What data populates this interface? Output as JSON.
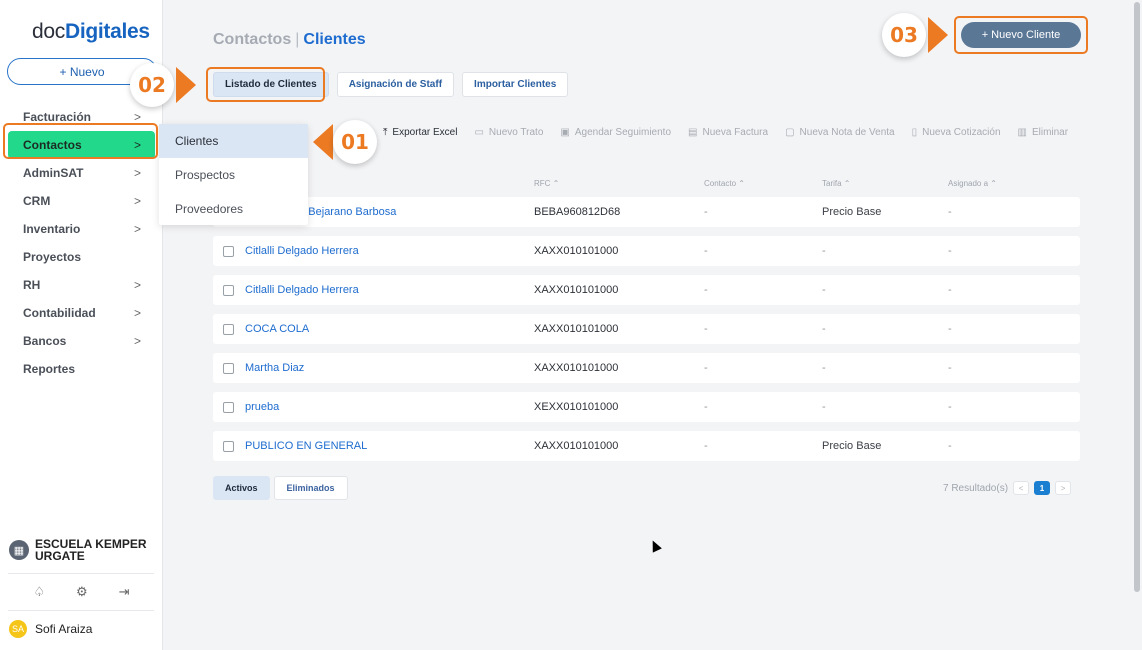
{
  "sidebar": {
    "logo_prefix": "doc",
    "logo_brand": "Digitales",
    "nuevo_button": "+ Nuevo",
    "items": [
      {
        "label": "Facturación",
        "chevron": ">"
      },
      {
        "label": "Contactos",
        "chevron": ">"
      },
      {
        "label": "AdminSAT",
        "chevron": ">"
      },
      {
        "label": "CRM",
        "chevron": ">"
      },
      {
        "label": "Inventario",
        "chevron": ">"
      },
      {
        "label": "Proyectos",
        "chevron": ""
      },
      {
        "label": "RH",
        "chevron": ">"
      },
      {
        "label": "Contabilidad",
        "chevron": ">"
      },
      {
        "label": "Bancos",
        "chevron": ">"
      },
      {
        "label": "Reportes",
        "chevron": ""
      }
    ],
    "org_name": "ESCUELA KEMPER URGATE",
    "user_initials": "SA",
    "user_name": "Sofi Araiza"
  },
  "submenu": {
    "items": [
      "Clientes",
      "Prospectos",
      "Proveedores"
    ]
  },
  "header": {
    "section": "Contactos",
    "separator": "|",
    "current": "Clientes",
    "new_client_button": "+ Nuevo Cliente"
  },
  "tabs": [
    "Listado de Clientes",
    "Asignación de Staff",
    "Importar Clientes"
  ],
  "toolbar": [
    {
      "icon": "upload-icon",
      "label": "Exportar Excel"
    },
    {
      "icon": "briefcase-icon",
      "label": "Nuevo Trato"
    },
    {
      "icon": "calendar-icon",
      "label": "Agendar Seguimiento"
    },
    {
      "icon": "invoice-icon",
      "label": "Nueva Factura"
    },
    {
      "icon": "document-icon",
      "label": "Nueva Nota de Venta"
    },
    {
      "icon": "file-icon",
      "label": "Nueva Cotización"
    },
    {
      "icon": "trash-icon",
      "label": "Eliminar"
    }
  ],
  "table": {
    "columns": [
      "RFC ⌃",
      "Contacto ⌃",
      "Tarifa ⌃",
      "Asignado a ⌃"
    ],
    "rows": [
      {
        "name": "do Bejarano Barbosa",
        "rfc": "BEBA960812D68",
        "contacto": "-",
        "tarifa": "Precio Base",
        "asignado": "-"
      },
      {
        "name": "Citlalli Delgado Herrera",
        "rfc": "XAXX010101000",
        "contacto": "-",
        "tarifa": "-",
        "asignado": "-"
      },
      {
        "name": "Citlalli Delgado Herrera",
        "rfc": "XAXX010101000",
        "contacto": "-",
        "tarifa": "-",
        "asignado": "-"
      },
      {
        "name": "COCA COLA",
        "rfc": "XAXX010101000",
        "contacto": "-",
        "tarifa": "-",
        "asignado": "-"
      },
      {
        "name": "Martha Diaz",
        "rfc": "XAXX010101000",
        "contacto": "-",
        "tarifa": "-",
        "asignado": "-"
      },
      {
        "name": "prueba",
        "rfc": "XEXX010101000",
        "contacto": "-",
        "tarifa": "-",
        "asignado": "-"
      },
      {
        "name": "PUBLICO EN GENERAL",
        "rfc": "XAXX010101000",
        "contacto": "-",
        "tarifa": "Precio Base",
        "asignado": "-"
      }
    ]
  },
  "footer": {
    "tab_active": "Activos",
    "tab_deleted": "Eliminados",
    "results": "7 Resultado(s)",
    "prev": "<",
    "page": "1",
    "next": ">"
  },
  "callouts": [
    "01",
    "02",
    "03"
  ],
  "colors": {
    "accent_green": "#22d88a",
    "annotation_orange": "#ec7a23",
    "primary_button": "#5b7796",
    "link_blue": "#1e6ccf"
  }
}
